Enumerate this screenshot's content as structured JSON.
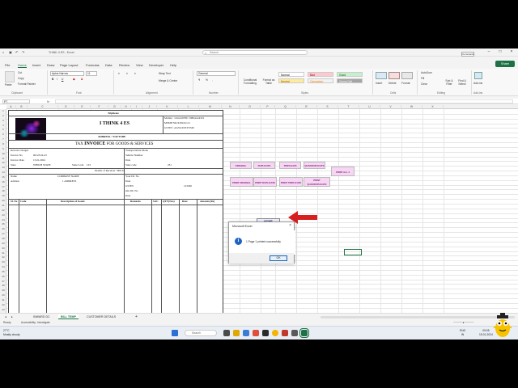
{
  "titlebar": {
    "title": "THINK 4 ES - Excel",
    "search_placeholder": "Search",
    "comments": "Comments"
  },
  "menu": [
    "File",
    "Home",
    "Insert",
    "Draw",
    "Page Layout",
    "Formulas",
    "Data",
    "Review",
    "View",
    "Developer",
    "Help"
  ],
  "share_label": "Share",
  "ribbon": {
    "paste": "Paste",
    "cut": "Cut",
    "copy": "Copy",
    "format_painter": "Format Painter",
    "font_name": "Aptos Narrow",
    "font_size": "11",
    "wrap_text": "Wrap Text",
    "merge_center": "Merge & Center",
    "number_format": "General",
    "conditional_formatting": "Conditional Formatting",
    "format_as_table": "Format as Table",
    "styles": [
      {
        "label": "Normal",
        "bg": "#ffffff",
        "fg": "#000000"
      },
      {
        "label": "Bad",
        "bg": "#ffc7ce",
        "fg": "#9c0006"
      },
      {
        "label": "Good",
        "bg": "#c6efce",
        "fg": "#006100"
      },
      {
        "label": "Neutral",
        "bg": "#ffeb9c",
        "fg": "#9c5700"
      },
      {
        "label": "Calculation",
        "bg": "#f2f2f2",
        "fg": "#fa7d00"
      },
      {
        "label": "Check Cell",
        "bg": "#a5a5a5",
        "fg": "#ffffff"
      }
    ],
    "insert": "Insert",
    "delete": "Delete",
    "format": "Format",
    "autosum": "AutoSum",
    "fill": "Fill",
    "clear": "Clear",
    "sort_filter": "Sort & Filter",
    "find_select": "Find & Select",
    "addins": "Add-ins",
    "groups": [
      "Clipboard",
      "Font",
      "Alignment",
      "Number",
      "Styles",
      "Cells",
      "Editing",
      "Add-ins"
    ]
  },
  "formula_bar": {
    "name_box": "P7",
    "fx": "fx"
  },
  "columns": [
    "A",
    "B",
    "C",
    "D",
    "E",
    "F",
    "G",
    "H",
    "I",
    "J",
    "K",
    "L",
    "M",
    "N",
    "O",
    "P",
    "Q",
    "R",
    "S",
    "T",
    "U",
    "V",
    "W",
    "X"
  ],
  "rows": [
    "1",
    "2",
    "3",
    "4",
    "5",
    "6",
    "7",
    "8",
    "9",
    "10",
    "11",
    "12",
    "13",
    "14",
    "15",
    "16",
    "17",
    "18",
    "19",
    "20",
    "21",
    "22",
    "23",
    "24",
    "25",
    "26",
    "27",
    "28",
    "29",
    "30",
    "31",
    "32",
    "33",
    "34",
    "35",
    "36",
    "37",
    "38",
    "39",
    "40",
    "41",
    "42",
    "43",
    "44"
  ],
  "invoice": {
    "copy_type": "Triplicate",
    "mobile": "Mobile : 12xxxx6789 / 098xxxx4321",
    "msme": "MSME NO.XXXX1111",
    "gstin": "GSTIN : AA52145XYZ540",
    "company": "I THINK 4 ES",
    "address": "ADDRESS : YOUTUBE",
    "title_prefix": "TAX ",
    "title_main": "INVOICE",
    "title_suffix": " FOR GOODS & SERVICES",
    "reverse_charges": "Reverse Charges",
    "invoice_no_label": "Invoice No",
    "invoice_no": "00123/24-25",
    "invoice_date_label": "Invoice Date",
    "invoice_date": "15.01.2024",
    "state_label": "State",
    "state": "WHICH STATE",
    "state_code_label": "State Code",
    "state_code": "123",
    "transport_mode": "Transportation Mode",
    "vehicle_number": "Vehicle Number",
    "date_label": "Date",
    "state_code_right": "State code",
    "state_code_right_val": "231",
    "receiver_details": "Details of Receiver / Bill To",
    "name_label": "Name",
    "name_value": "COMPANY NAME",
    "address_label": "Address",
    "address_value": "1 ADDRESS",
    "your_dc": "Your DC No",
    "gstin_label": "GSTIN",
    "gstin_value": "123456",
    "our_dc": "Our DC No",
    "headers": [
      "Sl. No",
      "Code",
      "Description of Goods",
      "Remarks",
      "SAC",
      "QTY(Nos)",
      "Rate",
      "Amount (Rs)"
    ]
  },
  "buttons": {
    "row1": [
      "ORIGINAL",
      "DUPLICATE",
      "TRIPLICATE",
      "QUADRUPLICATE"
    ],
    "print_all": "PRINT ALL 4",
    "row2": [
      "PRINT ORIGINAL",
      "PRINT DUPLICATE",
      "PRINT TRIPLICATE",
      "PRINT QUADRUPLICATE"
    ],
    "home": "HOME"
  },
  "dialog": {
    "title": "Microsoft Excel",
    "close": "×",
    "message": "1 Page 1 printed successfully",
    "icon": "i",
    "ok": "OK"
  },
  "sheets": [
    "INWARD DC",
    "BILL TEMP",
    "CUSTOMER DETAILS"
  ],
  "active_sheet": "BILL TEMP",
  "status": {
    "ready": "Ready",
    "accessibility": "Accessibility: Investigate",
    "zoom": "60%"
  },
  "taskbar": {
    "weather_temp": "27°C",
    "weather_desc": "Mostly cloudy",
    "search": "Search",
    "lang": "ENG",
    "region": "IN",
    "time": "09:05",
    "date": "15-01-2024"
  }
}
